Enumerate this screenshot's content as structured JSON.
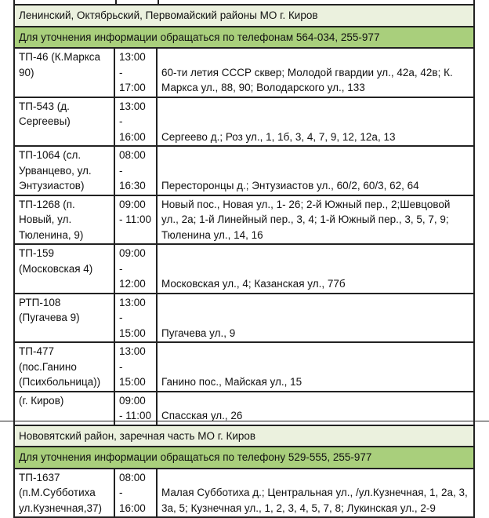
{
  "sections": [
    {
      "district": "Ленинский, Октябрьский, Первомайский районы МО г. Киров",
      "notice": "Для уточнения информации обращаться по телефонам 564-034, 255-977",
      "rows": [
        {
          "station": "ТП-46 (К.Маркса 90)",
          "time": "13:00 - 17:00",
          "streets": "60-ти летия СССР сквер; Молодой гвардии ул., 42а, 42в; К. Маркса ул., 88, 90; Володарского ул., 133"
        },
        {
          "station": "ТП-543 (д. Сергеевы)",
          "time": "13:00 - 16:00",
          "streets": "Сергеево д.; Роз ул., 1, 1б, 3, 4, 7, 9, 12, 12а, 13"
        },
        {
          "station": "ТП-1064 (сл. Урванцево, ул. Энтузиастов)",
          "time": "08:00 - 16:30",
          "streets": "Пересторонцы д.; Энтузиастов ул., 60/2, 60/3, 62, 64"
        },
        {
          "station": "ТП-1268 (п. Новый, ул. Тюленина, 9)",
          "time": "09:00 - 11:00",
          "streets": "Новый пос., Новая ул., 1- 26; 2-й Южный пер., 2;Шевцовой ул., 2а; 1-й Линейный пер., 3, 4; 1-й Южный пер., 3, 5, 7, 9; Тюленина ул., 14, 16"
        },
        {
          "station": "ТП-159 (Московская 4)",
          "time": "09:00 - 12:00",
          "streets": "Московская ул., 4; Казанская ул., 77б"
        },
        {
          "station": "РТП-108 (Пугачева 9)",
          "time": "13:00 - 15:00",
          "streets": "Пугачева ул., 9"
        },
        {
          "station": "ТП-477 (пос.Ганино (Психбольница))",
          "time": "13:00 - 15:00",
          "streets": "Ганино пос., Майская ул., 15"
        },
        {
          "station": "(г. Киров)",
          "time": "09:00 - 11:00",
          "streets": "Спасская ул., 26"
        }
      ]
    },
    {
      "district": "Нововятский район, заречная часть МО г. Киров",
      "notice": "Для уточнения информации обращаться по телефону 529-555, 255-977",
      "rows": [
        {
          "station": "ТП-1637 (п.М.Субботиха ул.Кузнечная,37)",
          "time": "08:00 - 16:00",
          "streets": "Малая Субботиха д.; Центральная ул., /ул.Кузнечная, 1, 2а, 3, 3а, 5; Кузнечная ул., 1, 2, 3, 4, 5, 7, 8; Лукинская ул., 2-9"
        }
      ]
    }
  ]
}
